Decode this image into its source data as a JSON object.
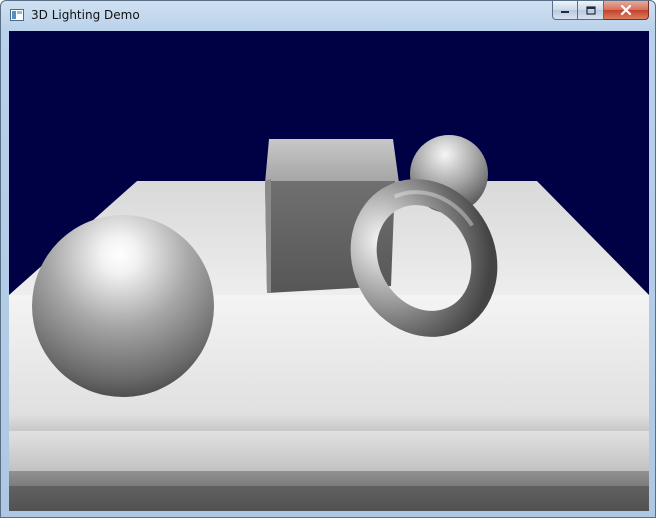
{
  "window": {
    "title": "3D Lighting Demo",
    "app_icon": "window-app-icon",
    "buttons": [
      {
        "name": "minimize-button",
        "icon": "minimize-icon"
      },
      {
        "name": "maximize-button",
        "icon": "maximize-icon"
      },
      {
        "name": "close-button",
        "icon": "close-icon"
      }
    ]
  },
  "scene": {
    "background_color": "#000044",
    "objects": [
      "floor-plane",
      "large-sphere",
      "cube",
      "small-sphere",
      "torus"
    ]
  }
}
